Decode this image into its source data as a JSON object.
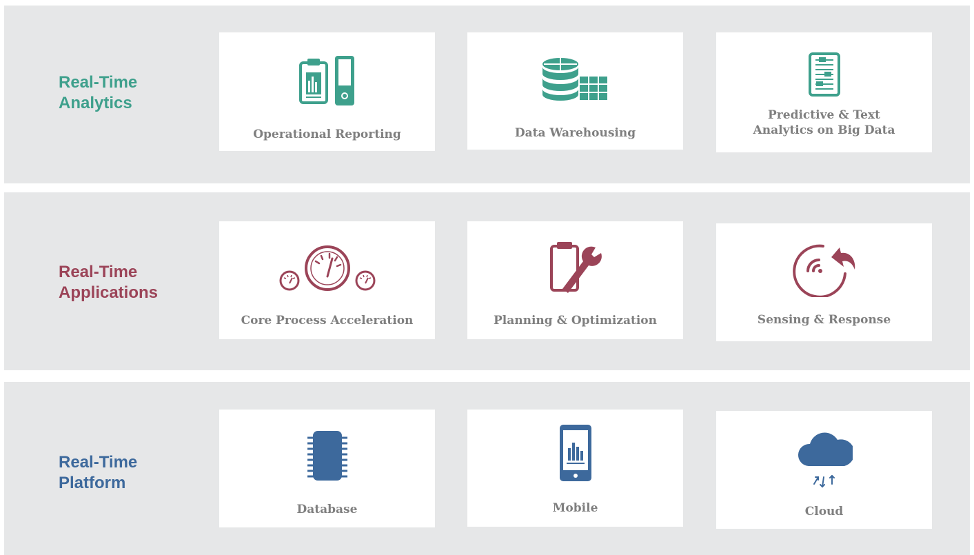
{
  "colors": {
    "analytics": "#3ea08c",
    "applications": "#9b4458",
    "platform": "#3d699c",
    "band_bg": "#e6e7e8",
    "card_text": "#7f7f7f"
  },
  "bands": [
    {
      "title_line1": "Real-Time",
      "title_line2": "Analytics",
      "cards": [
        {
          "icon": "reporting-icon",
          "label": "Operational Reporting"
        },
        {
          "icon": "database-grid-icon",
          "label": "Data Warehousing"
        },
        {
          "icon": "document-sliders-icon",
          "label_line1": "Predictive & Text",
          "label_line2": "Analytics on Big Data"
        }
      ]
    },
    {
      "title_line1": "Real-Time",
      "title_line2": "Applications",
      "cards": [
        {
          "icon": "gauges-icon",
          "label": "Core Process Acceleration"
        },
        {
          "icon": "clipboard-wrench-icon",
          "label": "Planning & Optimization"
        },
        {
          "icon": "sensor-arrow-icon",
          "label": "Sensing & Response"
        }
      ]
    },
    {
      "title_line1": "Real-Time",
      "title_line2": "Platform",
      "cards": [
        {
          "icon": "chip-icon",
          "label": "Database"
        },
        {
          "icon": "mobile-chart-icon",
          "label": "Mobile"
        },
        {
          "icon": "cloud-sync-icon",
          "label": "Cloud"
        }
      ]
    }
  ]
}
